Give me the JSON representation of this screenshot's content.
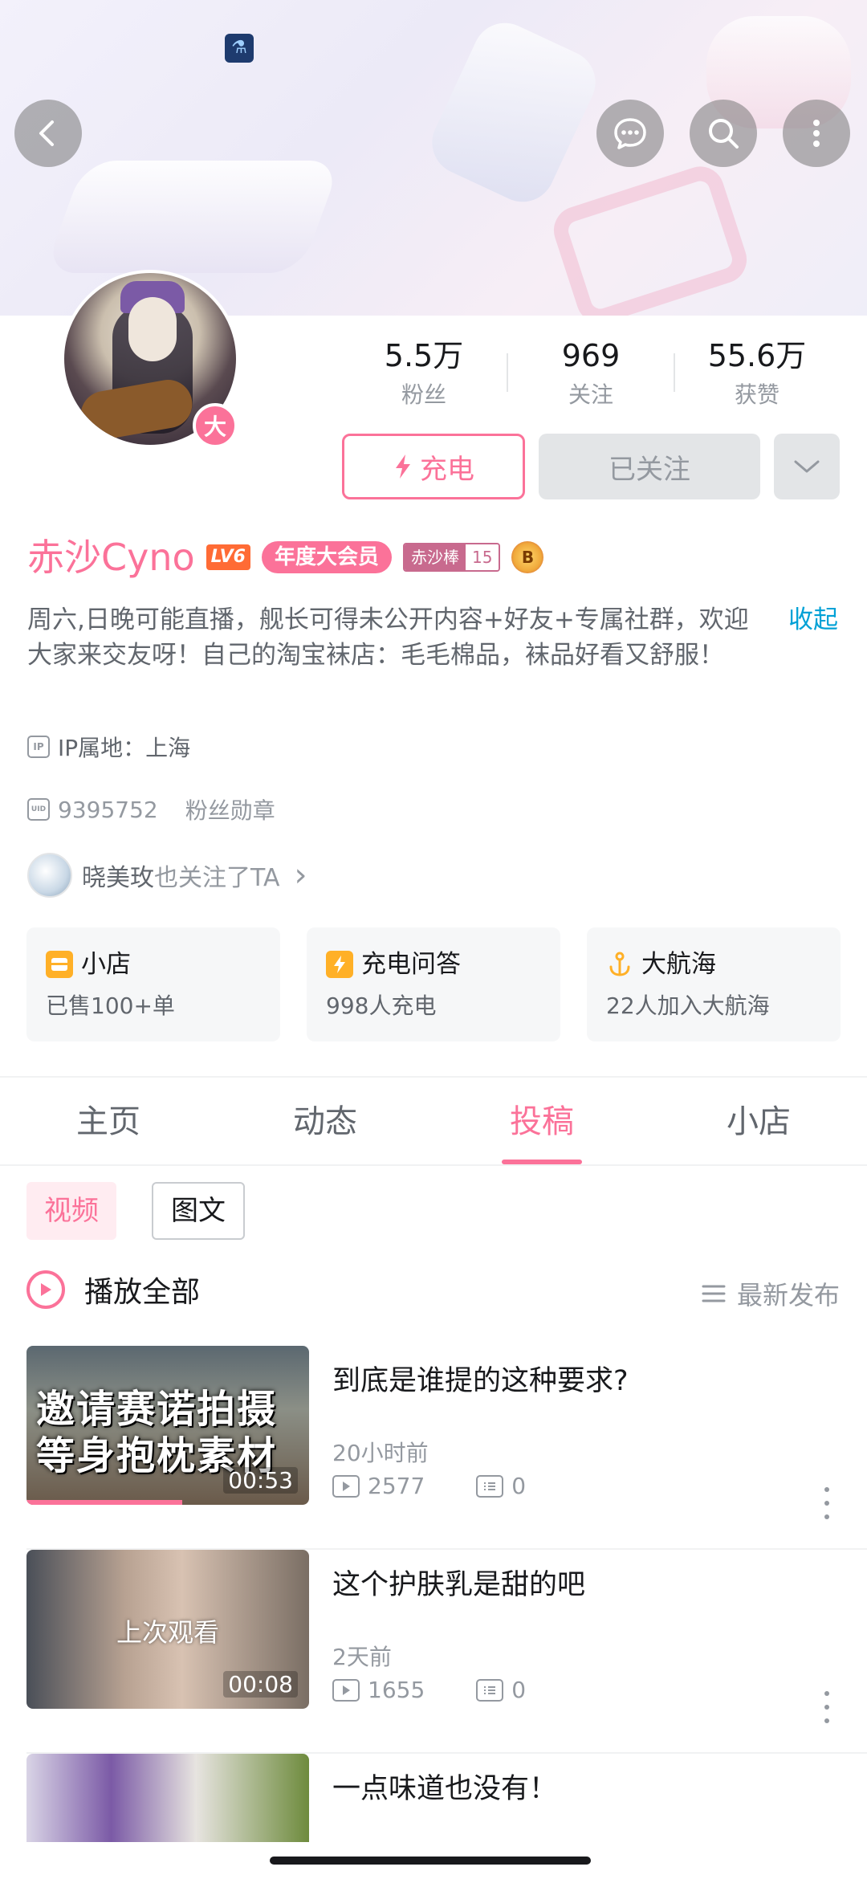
{
  "header": {
    "back_icon": "chevron-left-icon",
    "message_icon": "chat-bubble-icon",
    "search_icon": "search-icon",
    "more_icon": "more-vertical-icon"
  },
  "profile": {
    "name": "赤沙Cyno",
    "level_badge": "LV6",
    "vip_tag": "年度大会员",
    "avatar_badge": "大",
    "fan_medal": {
      "name": "赤沙棒",
      "level": "15"
    },
    "rank_badge": "B",
    "bio": "周六,日晚可能直播，舰长可得未公开内容+好友+专属社群，欢迎大家来交友呀！自己的淘宝袜店：毛毛棉品，袜品好看又舒服！",
    "collapse_label": "收起",
    "ip_icon_text": "IP",
    "ip_location": "IP属地：上海",
    "uid_icon_text": "UID",
    "uid": "9395752",
    "fan_medal_link": "粉丝勋章",
    "mutual_user": "晓美玫",
    "mutual_suffix": "也关注了TA",
    "mutual_arrow": "›"
  },
  "stats": {
    "fans_num": "5.5万",
    "fans_label": "粉丝",
    "follow_num": "969",
    "follow_label": "关注",
    "likes_num": "55.6万",
    "likes_label": "获赞"
  },
  "actions": {
    "charge_label": "充电",
    "followed_label": "已关注",
    "dropdown_icon": "chevron-down-icon"
  },
  "cards": [
    {
      "title": "小店",
      "sub": "已售100+单",
      "icon": "shop-icon",
      "icon_color": "#ffb027"
    },
    {
      "title": "充电问答",
      "sub": "998人充电",
      "icon": "lightning-icon",
      "icon_color": "#ffb027"
    },
    {
      "title": "大航海",
      "sub": "22人加入大航海",
      "icon": "anchor-icon",
      "icon_color": "#ffb027"
    }
  ],
  "tabs": [
    {
      "label": "主页",
      "active": false
    },
    {
      "label": "动态",
      "active": false
    },
    {
      "label": "投稿",
      "active": true
    },
    {
      "label": "小店",
      "active": false
    }
  ],
  "filters": {
    "video": "视频",
    "article": "图文"
  },
  "list_header": {
    "play_all": "播放全部",
    "sort": "最新发布"
  },
  "videos": [
    {
      "title": "到底是谁提的这种要求?",
      "time": "20小时前",
      "views": "2577",
      "comments": "0",
      "duration": "00:53",
      "overlay": "邀请赛诺拍摄等身抱枕素材",
      "progress": 0.55
    },
    {
      "title": "这个护肤乳是甜的吧",
      "time": "2天前",
      "views": "1655",
      "comments": "0",
      "duration": "00:08",
      "last_watched": "上次观看"
    },
    {
      "title": "一点味道也没有！"
    }
  ],
  "colors": {
    "accent": "#fb7299",
    "link": "#00a1d6",
    "muted": "#9499a0"
  }
}
